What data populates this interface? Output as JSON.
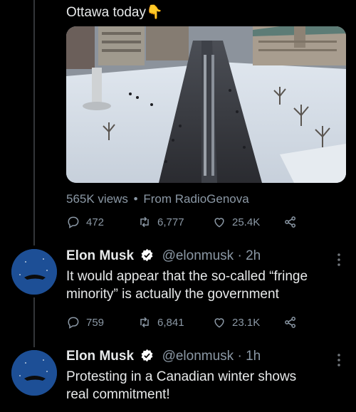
{
  "quoted_tweet": {
    "text": "Ottawa today",
    "emoji": "👇",
    "media_views": "565K views",
    "media_separator": "•",
    "media_source": "From RadioGenova",
    "replies": "472",
    "retweets": "6,777",
    "likes": "25.4K"
  },
  "replies": [
    {
      "name": "Elon Musk",
      "handle": "@elonmusk",
      "time": "· 2h",
      "text_line1": "It would appear that the so-called “fringe",
      "text_line2": "minority” is actually the government",
      "replies": "759",
      "retweets": "6,841",
      "likes": "23.1K"
    },
    {
      "name": "Elon Musk",
      "handle": "@elonmusk",
      "time": "· 1h",
      "text_line1": "Protesting in a Canadian winter shows",
      "text_line2": "real commitment!"
    }
  ],
  "colors": {
    "background": "#000000",
    "text": "#e7e9ea",
    "muted": "#8b98a5",
    "verified": "#1d9bf0"
  },
  "icons": [
    "reply-icon",
    "retweet-icon",
    "like-icon",
    "share-icon",
    "verified-icon",
    "more-icon",
    "pointing-down-emoji"
  ]
}
